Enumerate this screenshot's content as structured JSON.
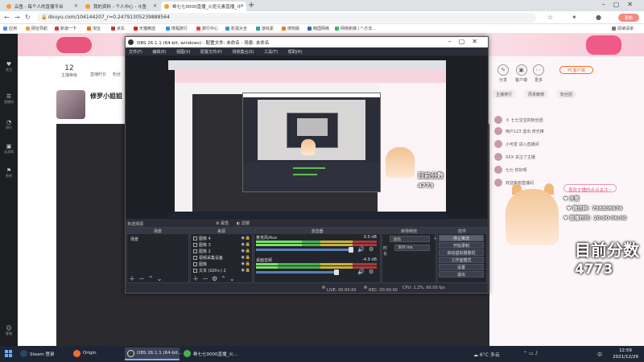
{
  "browser": {
    "tabs": [
      {
        "label": "云鱼 - 每个人的直播平台",
        "color": "#f0a030"
      },
      {
        "label": "我的资料 - 个人中心 - 斗鱼",
        "color": "#f0a030"
      },
      {
        "label": "希七七0000直播_火炬元素直播_斗",
        "color": "#f0a030"
      }
    ],
    "new_tab": "+",
    "address": "douyu.com/104144207_r=0.24791305239888564",
    "update_button": "更新",
    "bookmarks": [
      "应用",
      "网址导航",
      "新浪一下",
      "淘宝",
      "京东",
      "天猫精选",
      "携程旅行",
      "旅行中心",
      "影视大全",
      "游戏素",
      "搜狗版",
      "韩国网络",
      "网络新媒 | *-方法..."
    ],
    "bookmark_right": "阅读清单"
  },
  "douyu": {
    "left_nav": [
      {
        "glyph": "♥",
        "label": "关注"
      },
      {
        "glyph": "☰",
        "label": "直播间"
      },
      {
        "glyph": "◔",
        "label": "排行"
      },
      {
        "glyph": "▣",
        "label": "云游戏"
      },
      {
        "glyph": "⚑",
        "label": "鱼吧"
      },
      {
        "glyph": "☺",
        "label": "客服"
      }
    ],
    "stats": [
      {
        "value": "12",
        "label": "主播等级"
      },
      {
        "value": "",
        "label": "直播时长"
      },
      {
        "value": "",
        "label": "粉丝"
      }
    ],
    "anchor_name": "修罗小姐姐 -",
    "right_icons": [
      "分享",
      "客户端",
      "更多"
    ],
    "pc_button": "PC客户端",
    "rank_tabs": [
      "主播排行",
      "周贡献榜",
      "粉丝团"
    ],
    "chat": [
      "Ｘ 七七宝宝的粉丝团",
      "用户123 送出 荧光棒",
      "小可爱 进入直播间",
      "XXX 关注了主播",
      "七七 你好呀",
      "欢迎来到直播间"
    ],
    "overlay": {
      "bubble": "喜欢主播的点点关注~",
      "line1": "♥ 关管",
      "line2": "♥ 微信群：798808676",
      "line3": "♥ 直播时间：20:00-06:00",
      "big": "目前分数",
      "number": "4773"
    }
  },
  "obs": {
    "title": "OBS 26.1.1 (64-bit, windows) - 配置文件: 未命名 - 场景: 未命名",
    "menu": [
      "文件(F)",
      "编辑(E)",
      "视图(V)",
      "配置文件(P)",
      "场景集合(S)",
      "工具(T)",
      "帮助(H)"
    ],
    "preview_label": "未选择源",
    "preview_buttons": [
      "属性",
      "滤镜"
    ],
    "nested_overlay_text": "目前分数",
    "nested_overlay_number": "4773",
    "panels": {
      "scenes_header": "场景",
      "scenes": [
        "场景"
      ],
      "sources_header": "来源",
      "sources": [
        "图像 4",
        "图像 3",
        "图像 2",
        "视频采集设备",
        "图像",
        "文本 (GDI+) 2"
      ],
      "mixer_header": "混音器",
      "mixer": [
        {
          "name": "麦克风/Aux",
          "db": "0.0 dB",
          "level": 0.38
        },
        {
          "name": "桌面音频",
          "db": "-4.9 dB",
          "level": 0.18
        }
      ],
      "transitions_header": "转场特效",
      "transition_type": "淡出",
      "duration_label": "时长",
      "duration_value": "300 ms",
      "controls_header": "控件",
      "controls": [
        "停止推流",
        "开始录制",
        "启动虚拟摄像机",
        "工作室模式",
        "设置",
        "退出"
      ]
    },
    "status": {
      "live": "LIVE: 00:00:00",
      "rec": "REC: 00:00:00",
      "cpu": "CPU: 1.2%, 60.00 fps"
    }
  },
  "taskbar": {
    "apps": [
      {
        "label": "Steam 登录",
        "color": "#2a475e"
      },
      {
        "label": "Origin",
        "color": "#f56c2d"
      },
      {
        "label": "OBS 26.1.1 (64-bit...",
        "color": "#3a3a3a"
      },
      {
        "label": "希七七0000直播_火...",
        "color": "#4caf50"
      }
    ],
    "weather": "6°C 多云",
    "lang": "中",
    "time": "12:59",
    "date": "2021/12/29"
  }
}
